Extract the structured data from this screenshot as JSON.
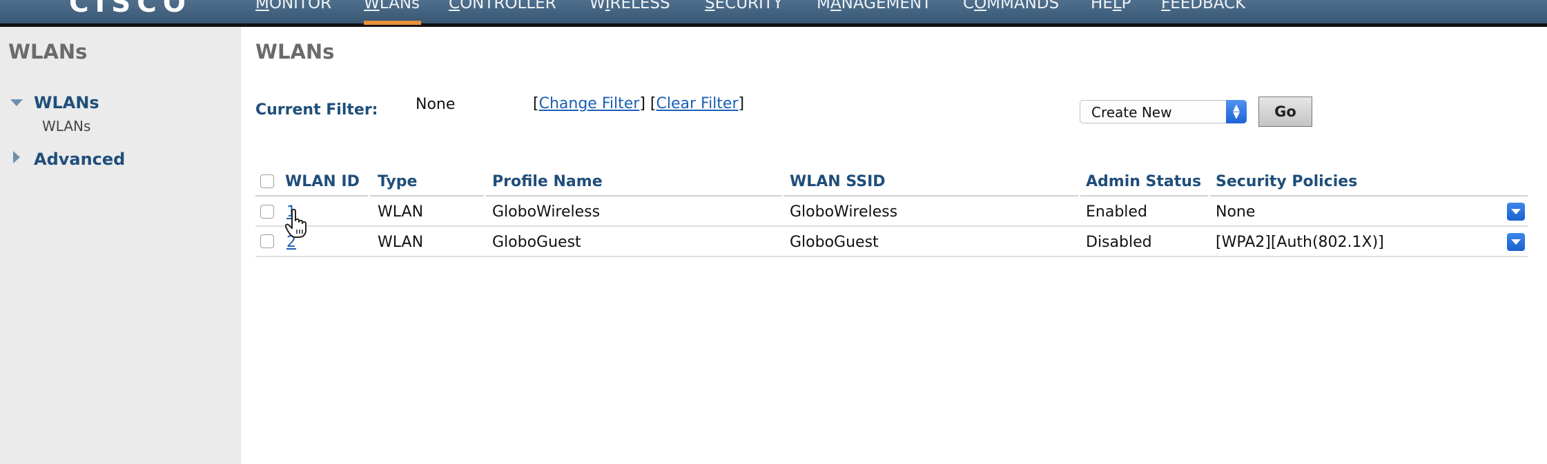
{
  "brand": {
    "logo_text": "CISCO"
  },
  "nav": {
    "items": [
      {
        "key": "M",
        "rest": "ONITOR"
      },
      {
        "key": "W",
        "rest": "LANs"
      },
      {
        "key": "C",
        "rest": "ONTROLLER"
      },
      {
        "pre": "W",
        "key": "I",
        "rest": "RELESS"
      },
      {
        "key": "S",
        "rest": "ECURITY"
      },
      {
        "pre": "M",
        "key": "A",
        "rest": "NAGEMENT"
      },
      {
        "pre": "C",
        "key": "O",
        "rest": "MMANDS"
      },
      {
        "pre": "HE",
        "key": "L",
        "rest": "P"
      },
      {
        "key": "F",
        "rest": "EEDBACK"
      }
    ],
    "active": "WLANs"
  },
  "sidebar": {
    "title": "WLANs",
    "sections": [
      {
        "label": "WLANs",
        "expanded": true,
        "children": [
          "WLANs"
        ]
      },
      {
        "label": "Advanced",
        "expanded": false
      }
    ]
  },
  "main": {
    "title": "WLANs",
    "filter": {
      "label": "Current Filter:",
      "value": "None",
      "change_label": "Change Filter",
      "clear_label": "Clear Filter"
    },
    "create_select": {
      "value": "Create New"
    },
    "go_label": "Go",
    "table": {
      "columns": [
        "WLAN ID",
        "Type",
        "Profile Name",
        "WLAN SSID",
        "Admin Status",
        "Security Policies"
      ],
      "rows": [
        {
          "id": "1",
          "type": "WLAN",
          "profile": "GloboWireless",
          "ssid": "GloboWireless",
          "status": "Enabled",
          "security": "None"
        },
        {
          "id": "2",
          "type": "WLAN",
          "profile": "GloboGuest",
          "ssid": "GloboGuest",
          "status": "Disabled",
          "security": "[WPA2][Auth(802.1X)]"
        }
      ]
    }
  },
  "colors": {
    "topbar": "#385773",
    "active_tab": "#e8913a",
    "heading_blue": "#1f4e7a",
    "link_blue": "#1a5fb4",
    "sidebar_bg": "#ebebeb"
  }
}
